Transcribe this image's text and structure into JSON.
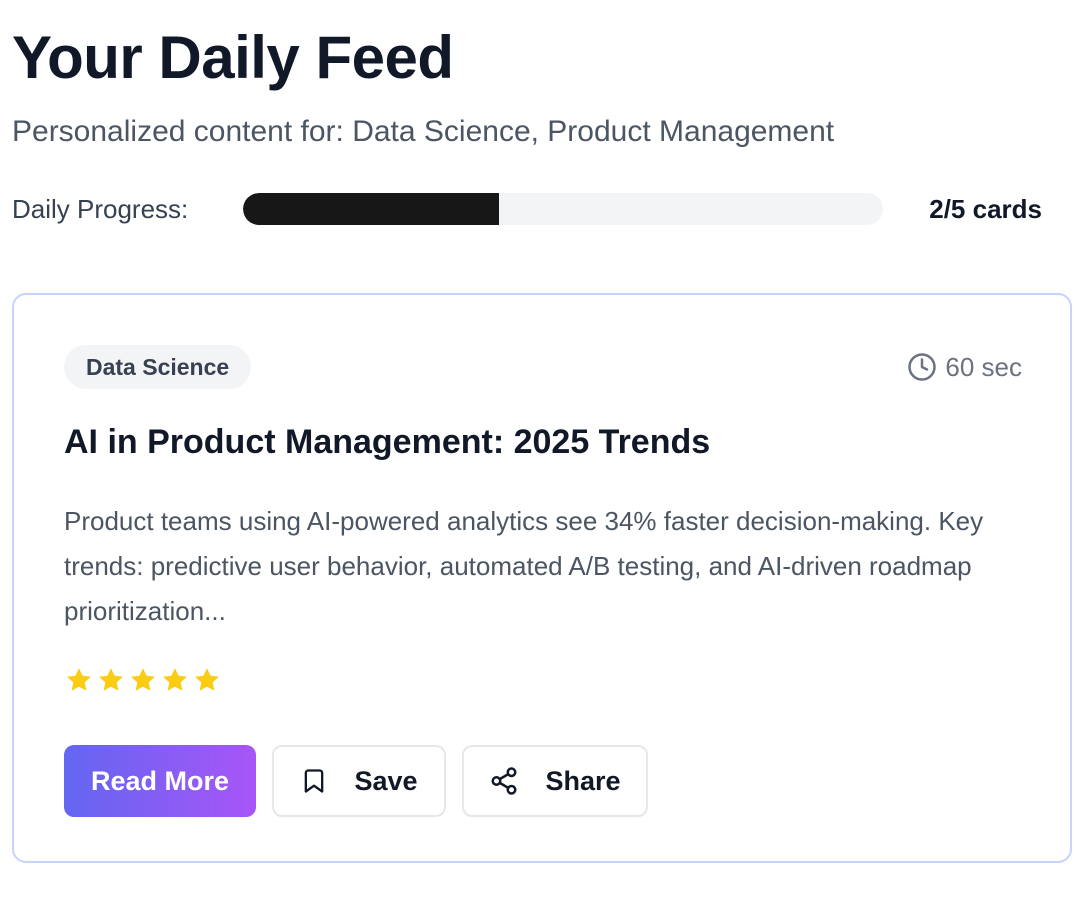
{
  "header": {
    "title": "Your Daily Feed",
    "subtitle": "Personalized content for: Data Science, Product Management"
  },
  "progress": {
    "label": "Daily Progress:",
    "completed": 2,
    "total": 5,
    "fraction": 0.4,
    "count_text": "2/5 cards"
  },
  "card": {
    "tag": "Data Science",
    "time_icon": "clock-icon",
    "time_text": "60 sec",
    "title": "AI in Product Management: 2025 Trends",
    "body": "Product teams using AI-powered analytics see 34% faster decision-making. Key trends: predictive user behavior, automated A/B testing, and AI-driven roadmap prioritization...",
    "rating": 5,
    "rating_max": 5,
    "star_icon": "star-icon",
    "star_color": "#facc15",
    "actions": {
      "read_more_label": "Read More",
      "save_label": "Save",
      "save_icon": "bookmark-icon",
      "share_label": "Share",
      "share_icon": "share-icon"
    }
  },
  "colors": {
    "accent_gradient_start": "#6366f1",
    "accent_gradient_end": "#a855f7",
    "card_border": "#c7d2fe",
    "progress_fill": "#171717",
    "progress_track": "#f3f4f6"
  }
}
